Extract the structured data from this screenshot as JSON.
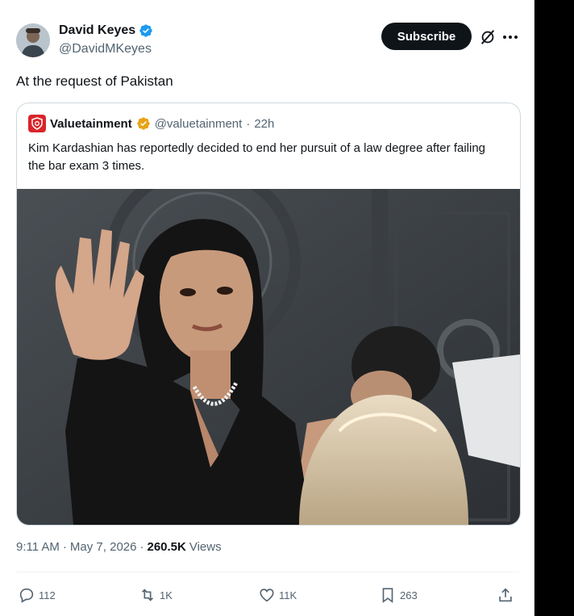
{
  "author": {
    "display_name": "David Keyes",
    "handle": "@DavidMKeyes",
    "verified": true,
    "verified_color": "#1d9bf0"
  },
  "header": {
    "subscribe_label": "Subscribe",
    "grok_icon": "grok-icon",
    "more_icon": "more-icon"
  },
  "tweet": {
    "text": "At the request of Pakistan"
  },
  "quoted": {
    "display_name": "Valuetainment",
    "verified_color": "#e8a317",
    "handle": "@valuetainment",
    "separator": "·",
    "time": "22h",
    "text": "Kim Kardashian has reportedly decided to end her pursuit of a law degree after failing the bar exam 3 times.",
    "brand_color": "#d9252a"
  },
  "meta": {
    "time": "9:11 AM",
    "dot1": "·",
    "date": "May 7, 2026",
    "dot2": "·",
    "views_count": "260.5K",
    "views_label": "Views"
  },
  "actions": {
    "reply_count": "112",
    "repost_count": "1K",
    "like_count": "11K",
    "bookmark_count": "263"
  }
}
